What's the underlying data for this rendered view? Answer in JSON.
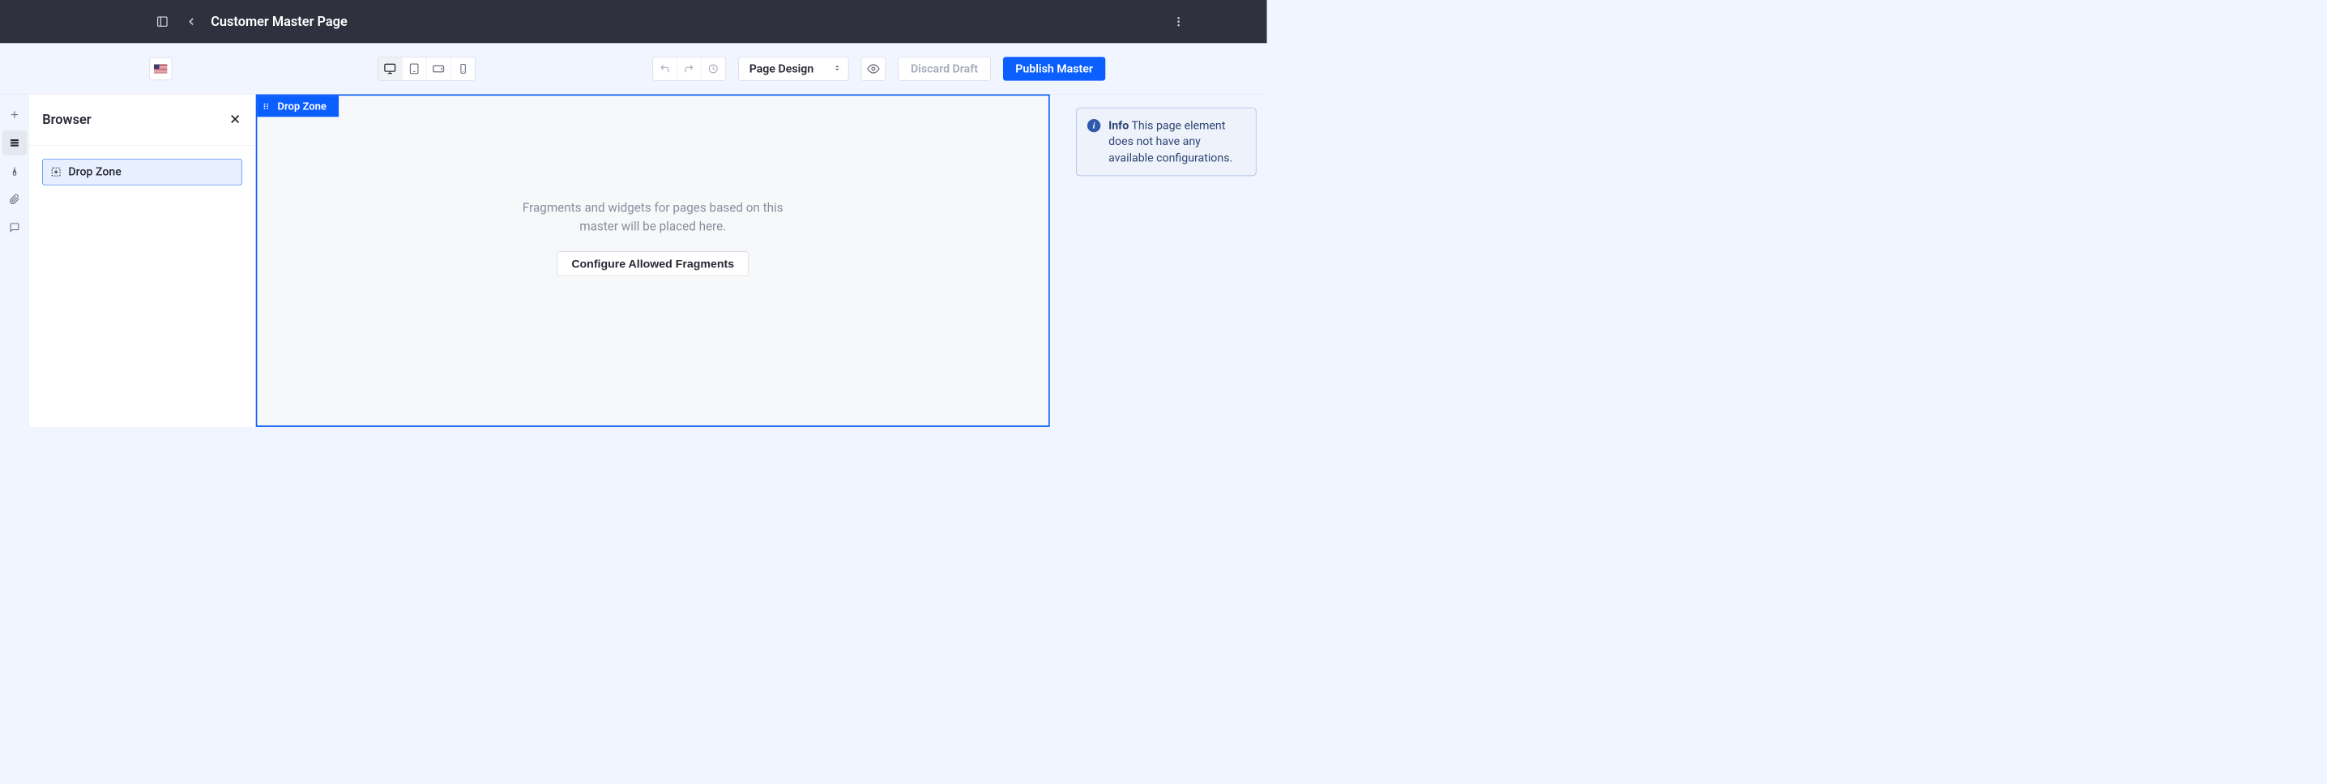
{
  "header": {
    "title": "Customer Master Page"
  },
  "toolbar": {
    "page_design_label": "Page Design",
    "discard_label": "Discard Draft",
    "publish_label": "Publish Master"
  },
  "browser": {
    "title": "Browser",
    "tree": {
      "drop_zone_label": "Drop Zone"
    }
  },
  "canvas": {
    "chip_label": "Drop Zone",
    "placeholder_text": "Fragments and widgets for pages based on this master will be placed here.",
    "configure_label": "Configure Allowed Fragments"
  },
  "config": {
    "info_label": "Info",
    "info_text": "This page element does not have any available configurations."
  }
}
